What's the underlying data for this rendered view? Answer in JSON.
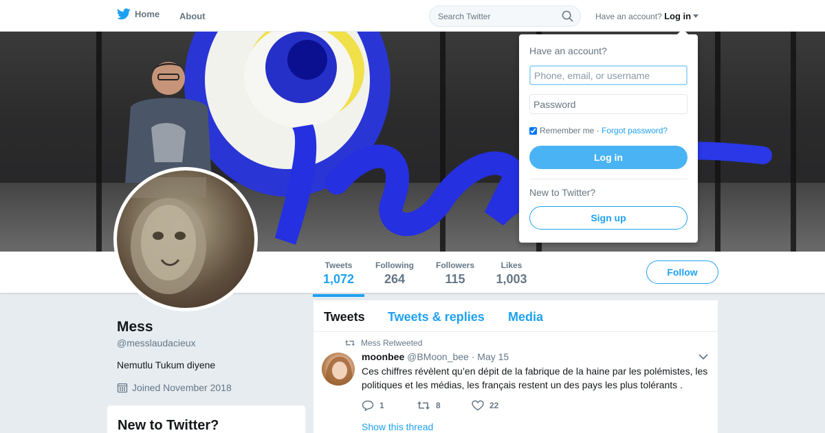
{
  "nav": {
    "home_label": "Home",
    "about_label": "About",
    "search_placeholder": "Search Twitter",
    "login_prompt": "Have an account?",
    "login_label": "Log in",
    "brand_color": "#1da1f2"
  },
  "stats": [
    {
      "label": "Tweets",
      "value": "1,072"
    },
    {
      "label": "Following",
      "value": "264"
    },
    {
      "label": "Followers",
      "value": "115"
    },
    {
      "label": "Likes",
      "value": "1,003"
    }
  ],
  "follow_label": "Follow",
  "profile": {
    "name": "Mess",
    "handle": "@messlaudacieux",
    "bio": "Nemutlu Tukum diyene",
    "joined": "Joined November 2018"
  },
  "new_to_twitter_heading": "New to Twitter?",
  "timeline": {
    "tabs": [
      "Tweets",
      "Tweets & replies",
      "Media"
    ],
    "tweet": {
      "retweet_label": "Mess Retweeted",
      "name": "moonbee",
      "handle": "@BMoon_bee",
      "date": "· May 15",
      "text": "Ces chiffres révèlent qu’en dépit de la fabrique de la haine par les polémistes, les politiques et les médias, les français restent un des pays les plus tolérants .",
      "replies": "1",
      "retweets": "8",
      "likes": "22",
      "thread_label": "Show this thread"
    }
  },
  "login_dropdown": {
    "title": "Have an account?",
    "username_placeholder": "Phone, email, or username",
    "password_placeholder": "Password",
    "remember_label": "Remember me",
    "separator": "·",
    "forgot_label": "Forgot password?",
    "login_button": "Log in",
    "new_prompt": "New to Twitter?",
    "signup_button": "Sign up"
  }
}
